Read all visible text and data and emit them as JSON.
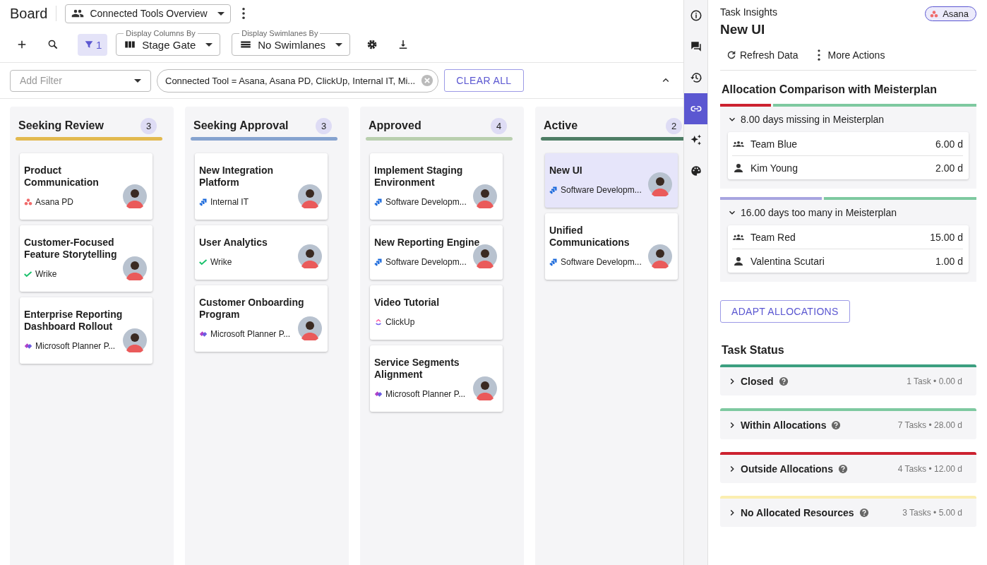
{
  "header": {
    "title": "Board",
    "view": "Connected Tools Overview"
  },
  "toolbar": {
    "filter_count": "1",
    "columns_by": {
      "label": "Display Columns By",
      "value": "Stage Gate"
    },
    "swimlanes_by": {
      "label": "Display Swimlanes By",
      "value": "No Swimlanes"
    }
  },
  "filter_bar": {
    "add_filter": {
      "placeholder": "Add Filter"
    },
    "chip": "Connected Tool = Asana, Asana PD, ClickUp, Internal IT, Mi...",
    "clear": "CLEAR ALL"
  },
  "columns": [
    {
      "title": "Seeking Review",
      "count": "3",
      "color": "#e2b94f",
      "cards": [
        {
          "title": "Product Communication",
          "source": "Asana PD",
          "kind": "asana",
          "avatar": true,
          "selected": false
        },
        {
          "title": "Customer-Focused Feature Storytelling",
          "source": "Wrike",
          "kind": "wrike",
          "avatar": true,
          "selected": false
        },
        {
          "title": "Enterprise Reporting Dashboard Rollout",
          "source": "Microsoft Planner P...",
          "kind": "planner",
          "avatar": true,
          "selected": false
        }
      ]
    },
    {
      "title": "Seeking Approval",
      "count": "3",
      "color": "#86a3cf",
      "cards": [
        {
          "title": "New Integration Platform",
          "source": "Internal IT",
          "kind": "jira",
          "avatar": true,
          "selected": false
        },
        {
          "title": "User Analytics",
          "source": "Wrike",
          "kind": "wrike",
          "avatar": true,
          "selected": false
        },
        {
          "title": "Customer Onboarding Program",
          "source": "Microsoft Planner P...",
          "kind": "planner",
          "avatar": true,
          "selected": false
        }
      ]
    },
    {
      "title": "Approved",
      "count": "4",
      "color": "#b9cfaf",
      "cards": [
        {
          "title": "Implement Staging Environment",
          "source": "Software Developm...",
          "kind": "jira",
          "avatar": true,
          "selected": false
        },
        {
          "title": "New Reporting Engine",
          "source": "Software Developm...",
          "kind": "jira",
          "avatar": true,
          "selected": false
        },
        {
          "title": "Video Tutorial",
          "source": "ClickUp",
          "kind": "clickup",
          "avatar": false,
          "selected": false
        },
        {
          "title": "Service Segments Alignment",
          "source": "Microsoft Planner P...",
          "kind": "planner",
          "avatar": true,
          "selected": false
        }
      ]
    },
    {
      "title": "Active",
      "count": "2",
      "color": "#4e7d65",
      "cards": [
        {
          "title": "New UI",
          "source": "Software Developm...",
          "kind": "jira",
          "avatar": true,
          "selected": true
        },
        {
          "title": "Unified Communications",
          "source": "Software Developm...",
          "kind": "jira",
          "avatar": true,
          "selected": false
        }
      ]
    }
  ],
  "rail": [
    {
      "kind": "info",
      "selected": false
    },
    {
      "kind": "comments",
      "selected": false
    },
    {
      "kind": "history",
      "selected": false
    },
    {
      "kind": "link",
      "selected": true
    },
    {
      "kind": "sparkle",
      "selected": false
    },
    {
      "kind": "palette",
      "selected": false
    }
  ],
  "insights": {
    "label": "Task Insights",
    "title": "New UI",
    "badge": "Asana",
    "actions": [
      "Refresh Data",
      "More Actions"
    ],
    "allocation": {
      "title": "Allocation Comparison with Meisterplan",
      "groups": [
        {
          "summary": "8.00 days missing in Meisterplan",
          "expanded": true,
          "bar": [
            {
              "color": "#cc2230",
              "level": 0.2
            },
            {
              "color": "#7ec9a0",
              "level": 0.8
            }
          ],
          "rows": [
            {
              "kind": "team",
              "name": "Team Blue",
              "value": "6.00 d"
            },
            {
              "kind": "person",
              "name": "Kim Young",
              "value": "2.00 d"
            }
          ]
        },
        {
          "summary": "16.00 days too many in Meisterplan",
          "expanded": true,
          "bar": [
            {
              "color": "#a7a5e0",
              "level": 0.4
            },
            {
              "color": "#7ec9a0",
              "level": 0.6
            }
          ],
          "rows": [
            {
              "kind": "team",
              "name": "Team Red",
              "value": "15.00 d"
            },
            {
              "kind": "person",
              "name": "Valentina Scutari",
              "value": "1.00 d"
            }
          ]
        }
      ],
      "button": "ADAPT ALLOCATIONS"
    },
    "status": {
      "title": "Task Status",
      "items": [
        {
          "label": "Closed",
          "meta": "1 Task • 0.00 d",
          "color": "#3c9f80",
          "expanded": false
        },
        {
          "label": "Within Allocations",
          "meta": "7 Tasks • 28.00 d",
          "color": "#7ec9a0",
          "expanded": false
        },
        {
          "label": "Outside Allocations",
          "meta": "4 Tasks • 12.00 d",
          "color": "#cc2230",
          "expanded": false
        },
        {
          "label": "No Allocated Resources",
          "meta": "3 Tasks • 5.00 d",
          "color": "#fbeeb0",
          "expanded": false
        }
      ]
    }
  }
}
